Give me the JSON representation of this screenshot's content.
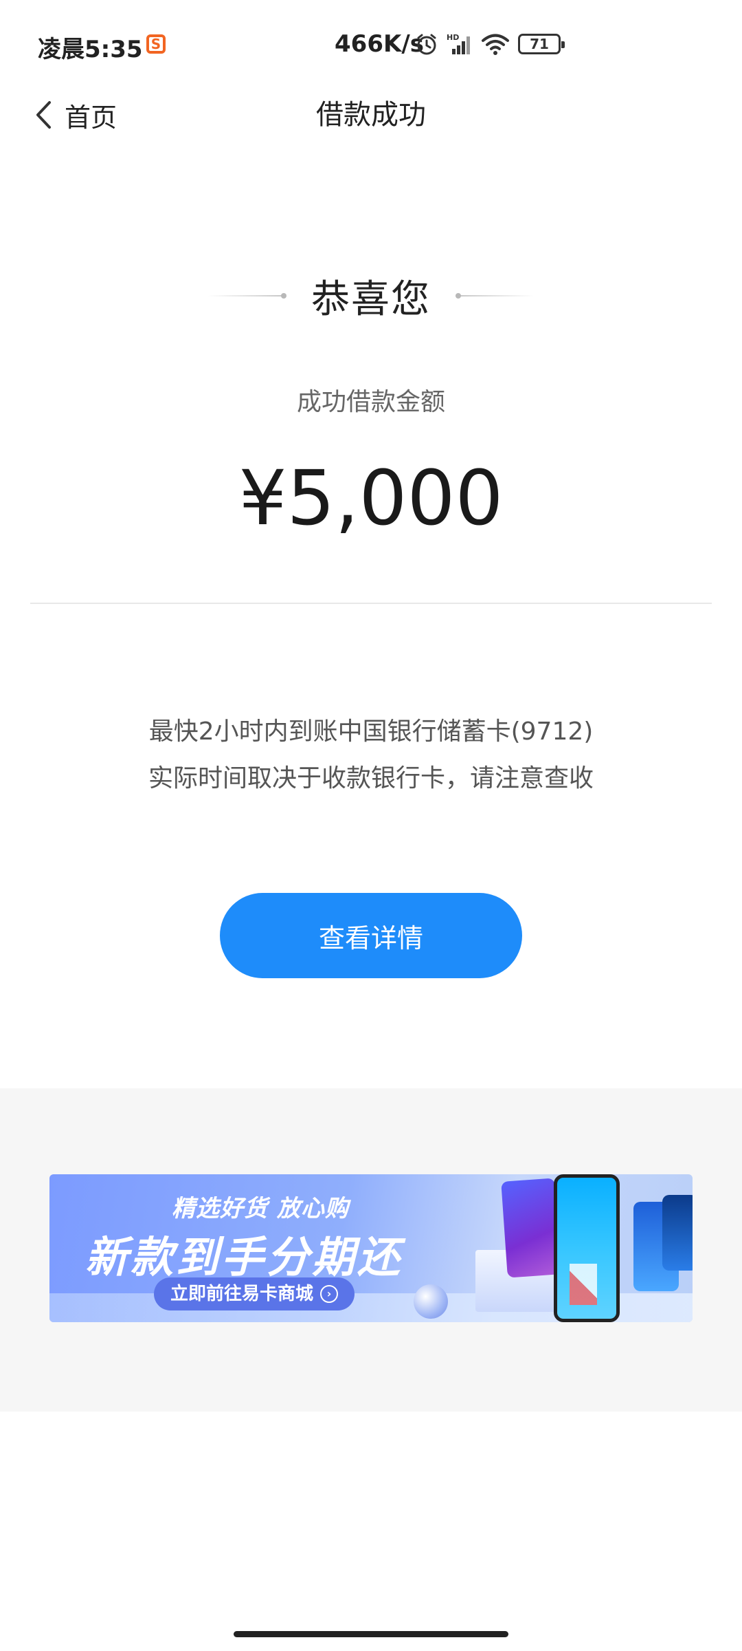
{
  "status_bar": {
    "time": "凌晨5:35",
    "app_badge": "S",
    "network_speed": "466K/s",
    "battery_level": "71",
    "icons": [
      "alarm-icon",
      "hd-signal-icon",
      "wifi-icon",
      "battery-icon"
    ]
  },
  "nav": {
    "back_label": "首页",
    "title": "借款成功"
  },
  "result": {
    "congrats": "恭喜您",
    "amount_label": "成功借款金额",
    "amount_value": "¥5,000"
  },
  "info": {
    "line1": "最快2小时内到账中国银行储蓄卡(9712)",
    "line2": "实际时间取决于收款银行卡，请注意查收"
  },
  "actions": {
    "detail_button": "查看详情"
  },
  "banner": {
    "subtitle": "精选好货 放心购",
    "headline": "新款到手分期还",
    "cta": "立即前往易卡商城"
  },
  "colors": {
    "primary": "#1e8cfa",
    "promo_bg": "#f6f6f6",
    "app_badge": "#f26522"
  }
}
